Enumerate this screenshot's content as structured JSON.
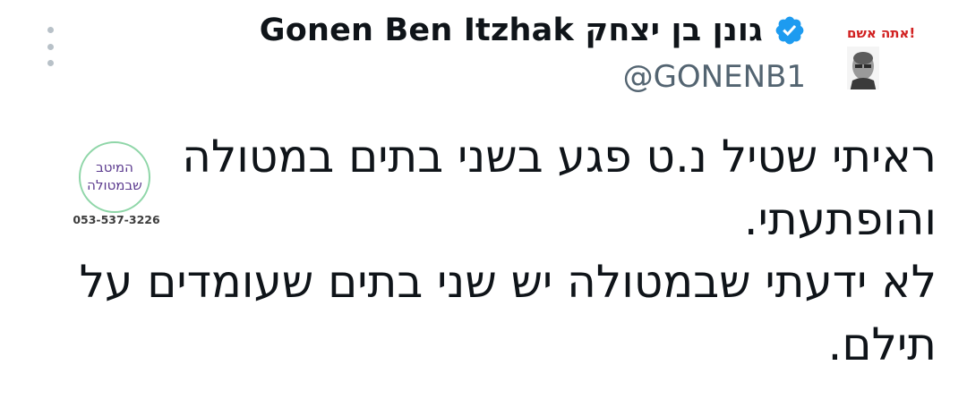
{
  "author": {
    "display_name": "Gonen Ben Itzhak גונן בן יצחק",
    "handle": "@GONENB1",
    "verified": true,
    "avatar_caption": "!אתה אשם"
  },
  "tweet": {
    "lines": [
      "ראיתי שטיל נ.ט פגע בשני בתים במטולה",
      "והופתעתי.",
      "לא ידעתי שבמטולה יש שני בתים שעומדים על",
      "תילם."
    ]
  },
  "watermark": {
    "line1": "המיטב",
    "line2": "שבמטולה",
    "phone": "053-537-3226"
  },
  "icons": {
    "more": "more-vertical-icon",
    "verified": "verified-badge-icon"
  },
  "colors": {
    "verified_blue": "#1d9bf0",
    "text_primary": "#0f1419",
    "text_secondary": "#536471",
    "avatar_caption_red": "#d12020",
    "watermark_purple": "#5b3a8e",
    "watermark_green": "#8fd6a8"
  }
}
